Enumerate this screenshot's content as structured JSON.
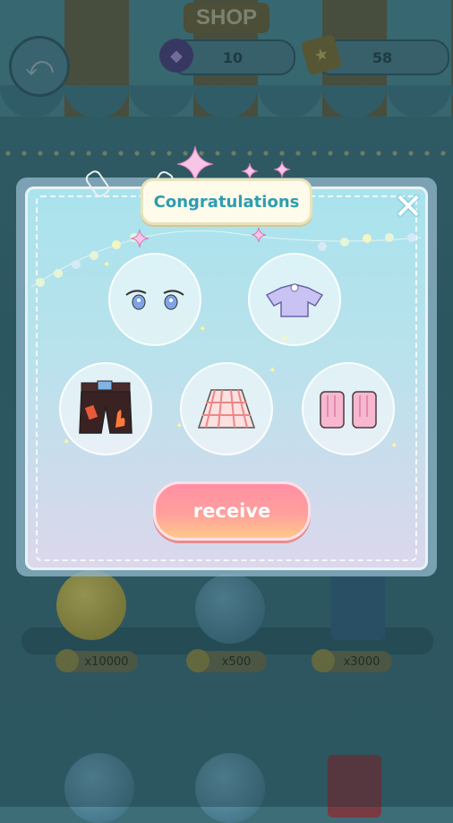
{
  "header": {
    "shop_title": "SHOP",
    "gems_count": "10",
    "tickets_count": "58"
  },
  "shelf": {
    "prices": [
      "x10000",
      "x500",
      "x3000"
    ]
  },
  "popup": {
    "title": "Congratulations",
    "items": [
      "eyes",
      "blouse",
      "shorts",
      "plaid-skirt",
      "gloves"
    ],
    "receive_label": "receive"
  },
  "colors": {
    "title_text": "#2e9db1",
    "receive_button": "#ff9f9c",
    "popup_bg": "#a9e3ed"
  }
}
